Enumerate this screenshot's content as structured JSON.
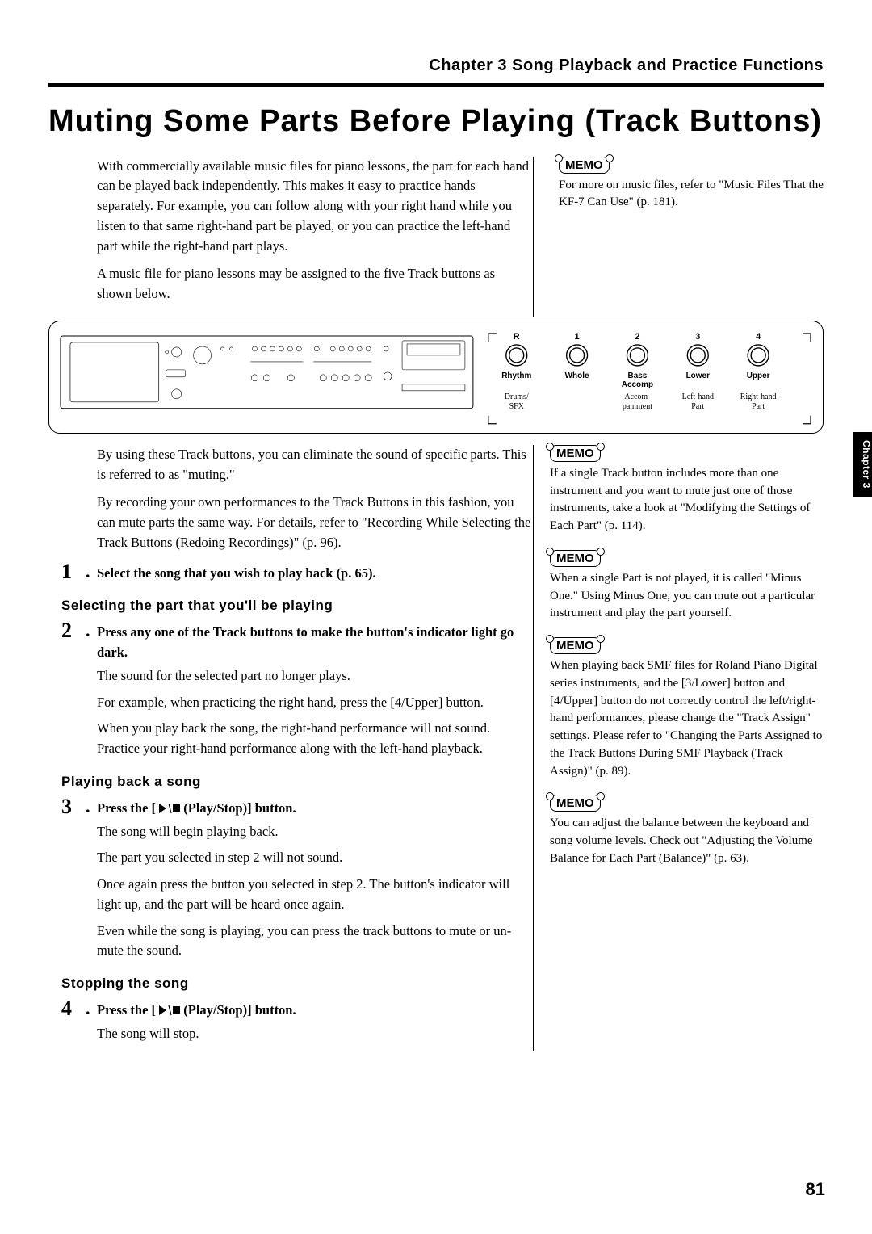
{
  "chapter_header": "Chapter 3 Song Playback and Practice Functions",
  "title": "Muting Some Parts Before Playing (Track Buttons)",
  "intro_p1": "With commercially available music files for piano lessons, the part for each hand can be played back independently. This makes it easy to practice hands separately. For example, you can follow along with your right hand while you listen to that same right-hand part be played, or you can practice the left-hand part while the right-hand part plays.",
  "intro_p2": "A music file for piano lessons may be assigned to the five Track buttons as shown below.",
  "memo1": "For more on music files, refer to \"Music Files That the KF-7 Can Use\" (p. 181).",
  "diagram": {
    "tracks": [
      {
        "num": "R",
        "label": "Rhythm",
        "sub": "Drums/\nSFX"
      },
      {
        "num": "1",
        "label": "Whole",
        "sub": ""
      },
      {
        "num": "2",
        "label": "Bass\nAccomp",
        "sub": "Accom-\npaniment"
      },
      {
        "num": "3",
        "label": "Lower",
        "sub": "Left-hand\nPart"
      },
      {
        "num": "4",
        "label": "Upper",
        "sub": "Right-hand\nPart"
      }
    ]
  },
  "after_diagram_p1": "By using these Track buttons, you can eliminate the sound of specific parts. This is referred to as \"muting.\"",
  "after_diagram_p2": "By recording your own performances to the Track Buttons in this fashion, you can mute parts the same way. For details, refer to \"Recording While Selecting the Track Buttons (Redoing Recordings)\" (p. 96).",
  "memo2": "If a single Track button includes more than one instrument and you want to mute just one of those instruments, take a look at \"Modifying the Settings of Each Part\" (p. 114).",
  "memo3": "When a single Part is not played, it is called \"Minus One.\" Using Minus One, you can mute out a particular instrument and play the part yourself.",
  "memo4": "When playing back SMF files for Roland Piano Digital series instruments, and the [3/Lower] button and [4/Upper] button do not correctly control the left/right-hand performances, please change the \"Track Assign\" settings. Please refer to \"Changing the Parts Assigned to the Track Buttons During SMF Playback (Track Assign)\" (p. 89).",
  "memo5": "You can adjust the balance between the keyboard and song volume levels. Check out \"Adjusting the Volume Balance for Each Part (Balance)\" (p. 63).",
  "step1": "Select the song that you wish to play back (p. 65).",
  "subhead_select": "Selecting the part that you'll be playing",
  "step2": "Press any one of the Track buttons to make the button's indicator light go dark.",
  "step2_body1": "The sound for the selected part no longer plays.",
  "step2_body2": "For example, when practicing the right hand, press the [4/Upper] button.",
  "step2_body3": "When you play back the song, the right-hand performance will not sound. Practice your right-hand performance along with the left-hand playback.",
  "subhead_play": "Playing back a song",
  "step3_pre": "Press the [ ",
  "step3_post": " (Play/Stop)] button.",
  "step3_body1": "The song will begin playing back.",
  "step3_body2": "The part you selected in step 2 will not sound.",
  "step3_body3": "Once again press the button you selected in step 2. The button's indicator will light up, and the part will be heard once again.",
  "step3_body4": "Even while the song is playing, you can press the track buttons to mute or un-mute the sound.",
  "subhead_stop": "Stopping the song",
  "step4_pre": "Press the [ ",
  "step4_post": " (Play/Stop)] button.",
  "step4_body": "The song will stop.",
  "tab_label": "Chapter 3",
  "page_number": "81",
  "memo_label": "MEMO"
}
